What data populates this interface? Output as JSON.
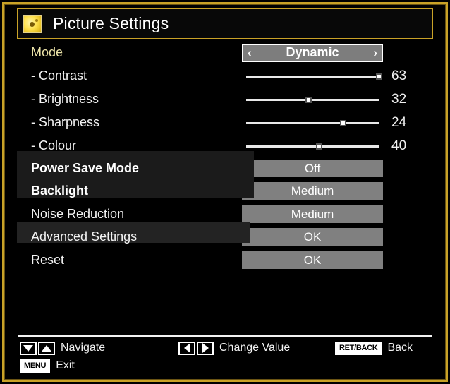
{
  "window": {
    "title": "Picture Settings",
    "icon": "picture-settings-icon",
    "frame_color": "#c9a227",
    "background": "#000000"
  },
  "menu": {
    "rows": [
      {
        "label": "Mode",
        "type": "selector",
        "value": "Dynamic",
        "left_arrow": "‹",
        "right_arrow": "›",
        "selected": false,
        "label_color": "#ece3a8"
      },
      {
        "label": "- Contrast",
        "type": "slider",
        "value": 63,
        "min": 0,
        "max": 63,
        "percent": 100
      },
      {
        "label": "- Brightness",
        "type": "slider",
        "value": 32,
        "min": 0,
        "max": 63,
        "percent": 47
      },
      {
        "label": "- Sharpness",
        "type": "slider",
        "value": 24,
        "min": 0,
        "max": 33,
        "percent": 73
      },
      {
        "label": "- Colour",
        "type": "slider",
        "value": 40,
        "min": 0,
        "max": 80,
        "percent": 55
      },
      {
        "label": "Power Save Mode",
        "type": "button",
        "value": "Off",
        "selected": true
      },
      {
        "label": "Backlight",
        "type": "button",
        "value": "Medium",
        "selected": true
      },
      {
        "label": "Noise Reduction",
        "type": "button",
        "value": "Medium",
        "selected": false
      },
      {
        "label": "Advanced Settings",
        "type": "button",
        "value": "OK",
        "selected": false
      },
      {
        "label": "Reset",
        "type": "button",
        "value": "OK",
        "selected": false
      }
    ]
  },
  "footer": {
    "navigate_label": "Navigate",
    "change_value_label": "Change Value",
    "back_key": "RET/BACK",
    "back_label": "Back",
    "menu_key": "MENU",
    "exit_label": "Exit"
  }
}
